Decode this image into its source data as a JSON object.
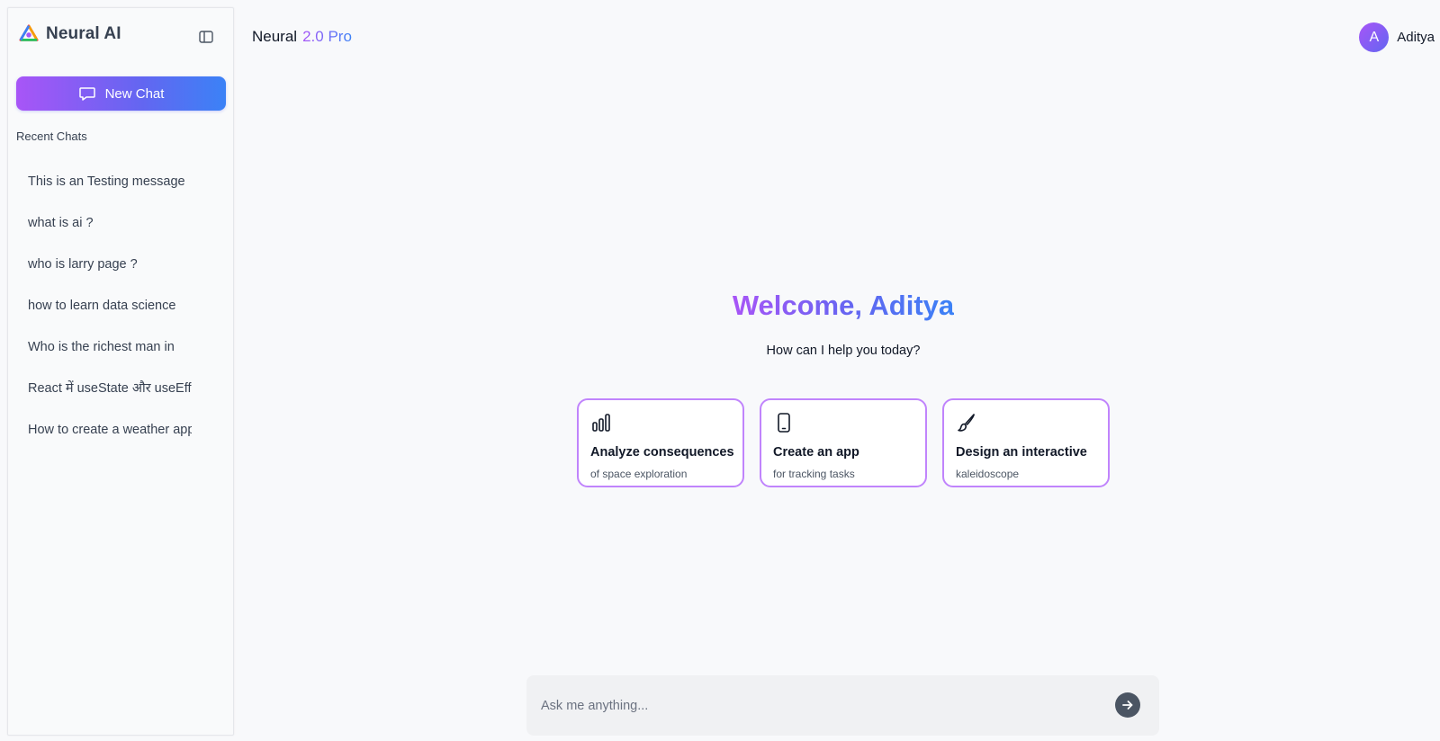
{
  "sidebar": {
    "brand": "Neural AI",
    "new_chat_label": "New Chat",
    "recent_title": "Recent Chats",
    "recent_chats": [
      "This is an Testing message",
      "what is ai ?",
      "who is larry page ?",
      "how to learn data science",
      "Who is the richest man in",
      "React में useState और useEffect",
      "How to create a weather app"
    ]
  },
  "header": {
    "model_name": "Neural",
    "model_version": "2.0 Pro",
    "user_initial": "A",
    "user_name": "Aditya"
  },
  "welcome": {
    "title": "Welcome, Aditya",
    "subtitle": "How can I help you today?"
  },
  "suggestions": [
    {
      "icon": "bar-chart-icon",
      "title": "Analyze consequences",
      "subtitle": "of space exploration"
    },
    {
      "icon": "smartphone-icon",
      "title": "Create an app",
      "subtitle": "for tracking tasks"
    },
    {
      "icon": "brush-icon",
      "title": "Design an interactive",
      "subtitle": "kaleidoscope"
    }
  ],
  "input": {
    "placeholder": "Ask me anything..."
  },
  "colors": {
    "accent_start": "#a855f7",
    "accent_end": "#3b82f6",
    "card_border": "#c084fc"
  }
}
